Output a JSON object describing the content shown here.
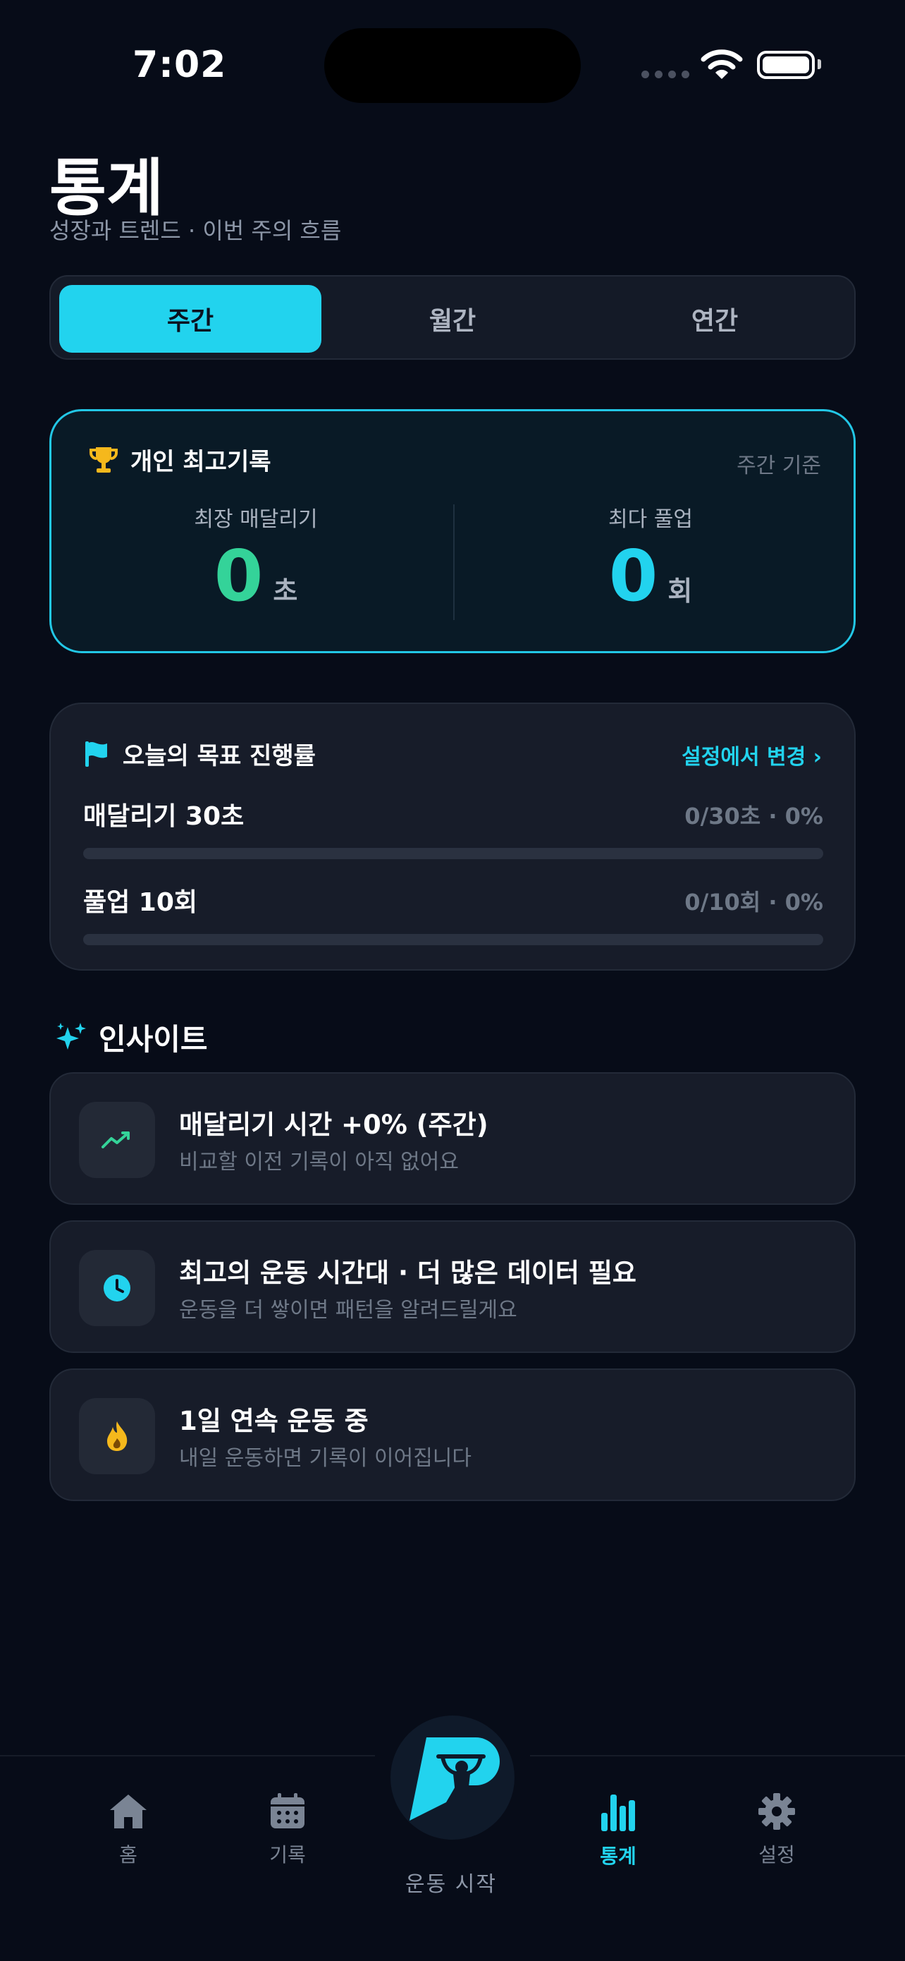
{
  "status_bar": {
    "time": "7:02"
  },
  "header": {
    "title": "통계",
    "subtitle": "성장과 트렌드 · 이번 주의 흐름"
  },
  "period_tabs": [
    {
      "label": "주간",
      "selected": true
    },
    {
      "label": "월간",
      "selected": false
    },
    {
      "label": "연간",
      "selected": false
    }
  ],
  "personal_best": {
    "title": "개인 최고기록",
    "basis": "주간 기준",
    "hang": {
      "label": "최장 매달리기",
      "value": "0",
      "unit": "초"
    },
    "pullup": {
      "label": "최다 풀업",
      "value": "0",
      "unit": "회"
    }
  },
  "goals": {
    "title": "오늘의 목표 진행률",
    "link": "설정에서 변경 ›",
    "items": [
      {
        "name": "매달리기 30초",
        "stat": "0/30초 · 0%",
        "progress": 0
      },
      {
        "name": "풀업 10회",
        "stat": "0/10회 · 0%",
        "progress": 0
      }
    ]
  },
  "insights": {
    "title": "인사이트",
    "items": [
      {
        "icon": "trend-up-icon",
        "title": "매달리기 시간 +0% (주간)",
        "subtitle": "비교할 이전 기록이 아직 없어요"
      },
      {
        "icon": "clock-icon",
        "title": "최고의 운동 시간대 · 더 많은 데이터 필요",
        "subtitle": "운동을 더 쌓이면 패턴을 알려드릴게요"
      },
      {
        "icon": "flame-icon",
        "title": "1일 연속 운동 중",
        "subtitle": "내일 운동하면 기록이 이어집니다"
      }
    ]
  },
  "tab_bar": {
    "home": "홈",
    "records": "기록",
    "start": "운동 시작",
    "stats": "통계",
    "settings": "설정",
    "active": "stats"
  },
  "colors": {
    "accent": "#22d3ee",
    "green": "#34d399",
    "gold": "#f5b81c",
    "background": "#070c18"
  }
}
